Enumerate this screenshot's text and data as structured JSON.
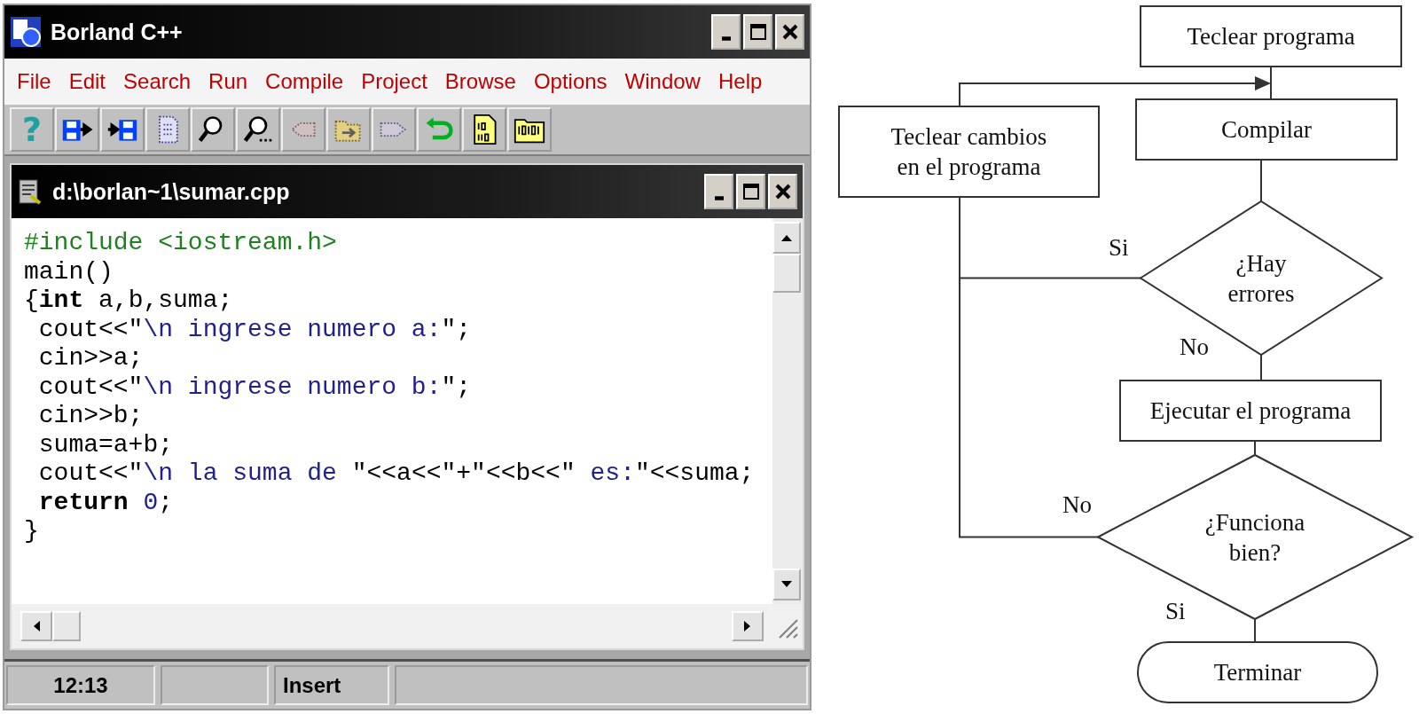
{
  "window": {
    "title": "Borland C++"
  },
  "menu": [
    "File",
    "Edit",
    "Search",
    "Run",
    "Compile",
    "Project",
    "Browse",
    "Options",
    "Window",
    "Help"
  ],
  "toolbar": [
    {
      "kind": "help",
      "glyph": "?"
    },
    {
      "kind": "save"
    },
    {
      "kind": "load"
    },
    {
      "kind": "page"
    },
    {
      "kind": "find"
    },
    {
      "kind": "find-more"
    },
    {
      "kind": "prev"
    },
    {
      "kind": "folder-next"
    },
    {
      "kind": "next"
    },
    {
      "kind": "undo"
    },
    {
      "kind": "binary-page"
    },
    {
      "kind": "binary-folder"
    }
  ],
  "editor": {
    "title": "d:\\borlan~1\\sumar.cpp",
    "lines": [
      [
        {
          "kind": "directive",
          "text": "#include <iostream.h>"
        }
      ],
      [
        {
          "kind": "plain",
          "text": "main()"
        }
      ],
      [
        {
          "kind": "plain",
          "text": "{"
        },
        {
          "kind": "keyword",
          "text": "int"
        },
        {
          "kind": "plain",
          "text": " a,b,suma;"
        }
      ],
      [
        {
          "kind": "plain",
          "text": " cout<<\""
        },
        {
          "kind": "string",
          "text": "\\n ingrese numero a:"
        },
        {
          "kind": "plain",
          "text": "\";"
        }
      ],
      [
        {
          "kind": "plain",
          "text": " cin>>a;"
        }
      ],
      [
        {
          "kind": "plain",
          "text": " cout<<\""
        },
        {
          "kind": "string",
          "text": "\\n ingrese numero b:"
        },
        {
          "kind": "plain",
          "text": "\";"
        }
      ],
      [
        {
          "kind": "plain",
          "text": " cin>>b;"
        }
      ],
      [
        {
          "kind": "plain",
          "text": " suma=a+b;"
        }
      ],
      [
        {
          "kind": "plain",
          "text": " cout<<\""
        },
        {
          "kind": "string",
          "text": "\\n la suma de "
        },
        {
          "kind": "plain",
          "text": "\"<<a<<\"+\"<<b<<\""
        },
        {
          "kind": "string",
          "text": " es:"
        },
        {
          "kind": "plain",
          "text": "\"<<suma;"
        }
      ],
      [
        {
          "kind": "keyword",
          "text": " return"
        },
        {
          "kind": "number",
          "text": " 0"
        },
        {
          "kind": "plain",
          "text": ";"
        }
      ],
      [
        {
          "kind": "plain",
          "text": "}"
        }
      ]
    ]
  },
  "status_bar": {
    "position": "12:13",
    "mode": "Insert"
  },
  "flowchart": {
    "nodes": [
      {
        "kind": "process",
        "lines": [
          "Teclear programa"
        ]
      },
      {
        "kind": "process",
        "lines": [
          "Teclear cambios",
          "en el programa"
        ]
      },
      {
        "kind": "process",
        "lines": [
          "Compilar"
        ]
      },
      {
        "kind": "decision",
        "lines": [
          "¿Hay",
          "errores"
        ]
      },
      {
        "kind": "process",
        "lines": [
          "Ejecutar el programa"
        ]
      },
      {
        "kind": "decision",
        "lines": [
          "¿Funciona",
          "bien?"
        ]
      },
      {
        "kind": "terminal",
        "lines": [
          "Terminar"
        ]
      }
    ],
    "labels": [
      "Si",
      "No",
      "No",
      "Si"
    ]
  }
}
